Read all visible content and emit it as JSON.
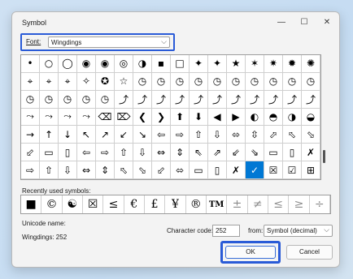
{
  "window": {
    "title": "Symbol",
    "minimize_glyph": "—",
    "maximize_glyph": "☐",
    "close_glyph": "✕"
  },
  "font": {
    "label": "Font:",
    "value": "Wingdings",
    "chevron": "⌵"
  },
  "symbol_grid": [
    [
      "•",
      "○",
      "◯",
      "◉",
      "◉",
      "◎",
      "◑",
      "▪",
      "□",
      "✦",
      "✦",
      "★",
      "✶",
      "✷",
      "✹",
      "✺"
    ],
    [
      "⌖",
      "⌖",
      "⌖",
      "✧",
      "✪",
      "☆",
      "◷",
      "◷",
      "◷",
      "◷",
      "◷",
      "◷",
      "◷",
      "◷",
      "◷",
      "◷"
    ],
    [
      "◷",
      "◷",
      "◷",
      "◷",
      "◷",
      "⤴",
      "⤴",
      "⤴",
      "⤴",
      "⤴",
      "⤴",
      "⤴",
      "⤴",
      "⤴",
      "⤴",
      "⤴"
    ],
    [
      "⤳",
      "⤳",
      "⤳",
      "⤳",
      "⌫",
      "⌦",
      "❮",
      "❯",
      "⬆",
      "⬇",
      "◀",
      "▶",
      "◐",
      "◓",
      "◑",
      "◒"
    ],
    [
      "→",
      "↑",
      "↓",
      "↖",
      "↗",
      "↙",
      "↘",
      "⇦",
      "⇨",
      "⇧",
      "⇩",
      "⬄",
      "⇳",
      "⬀",
      "⬁",
      "⬂"
    ],
    [
      "⬃",
      "▭",
      "▯",
      "⇦",
      "⇨",
      "⇧",
      "⇩",
      "⇔",
      "⇕",
      "⇖",
      "⇗",
      "⇙",
      "⇘",
      "▭",
      "▯",
      "✗"
    ],
    [
      "⇨",
      "⇧",
      "⇩",
      "⇔",
      "⇕",
      "⬁",
      "⬂",
      "⬃",
      "⬄",
      "▭",
      "▯",
      "✗",
      "✓",
      "☒",
      "☑",
      "⊞"
    ]
  ],
  "selected_index": {
    "row": 6,
    "col": 12
  },
  "recent": {
    "label": "Recently used symbols:",
    "items": [
      "■",
      "©",
      "☯",
      "☒",
      "≤",
      "€",
      "£",
      "¥",
      "®",
      "TM",
      "±",
      "≠",
      "≤",
      "≥",
      "÷"
    ]
  },
  "unicode_name_label": "Unicode name:",
  "unicode_name_value": "Wingdings: 252",
  "character_code": {
    "label": "Character code:",
    "value": "252"
  },
  "from": {
    "label": "from:",
    "value": "Symbol (decimal)",
    "chevron": "⌵"
  },
  "buttons": {
    "ok": "OK",
    "cancel": "Cancel"
  }
}
